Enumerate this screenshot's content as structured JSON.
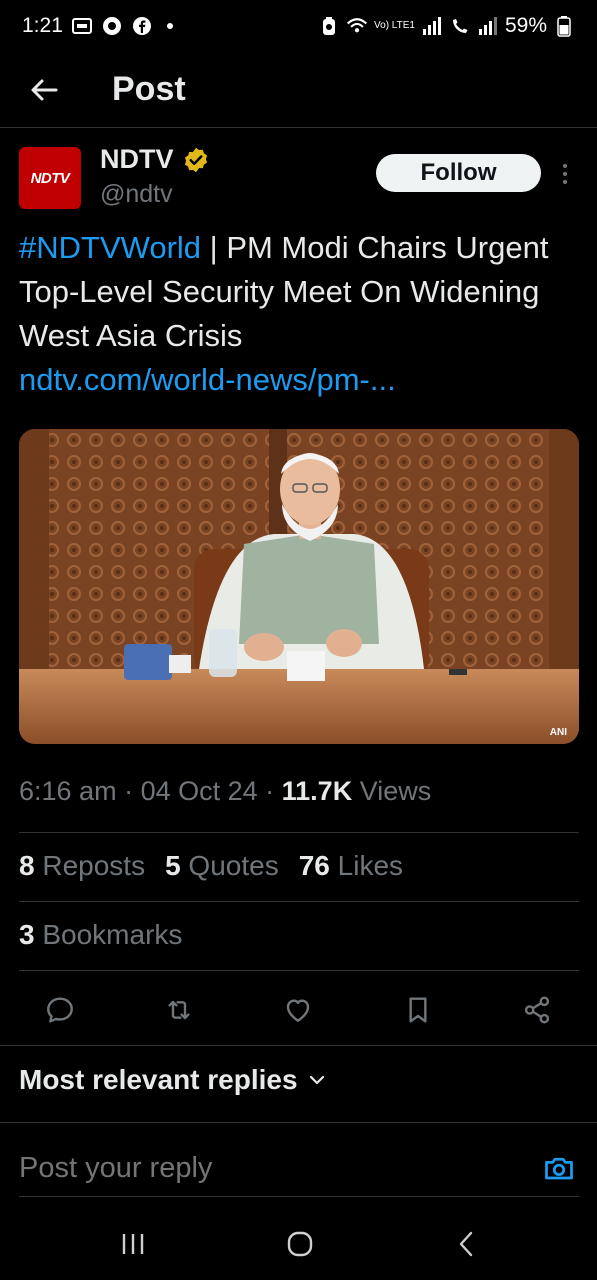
{
  "status_bar": {
    "time": "1:21",
    "signal_label": "Vo) LTE1",
    "battery": "59%"
  },
  "header": {
    "title": "Post"
  },
  "author": {
    "display_name": "NDTV",
    "handle": "@ndtv",
    "avatar_text": "NDTV",
    "verified_color": "#e2b719",
    "follow_label": "Follow"
  },
  "tweet": {
    "hashtag": "#NDTVWorld",
    "separator": " | ",
    "text": "PM Modi Chairs Urgent Top-Level Security Meet On Widening West Asia Crisis",
    "link": "ndtv.com/world-news/pm-...",
    "media_credit": "ANI"
  },
  "meta": {
    "time": "6:16 am",
    "dot1": " · ",
    "date": "04 Oct 24",
    "dot2": " · ",
    "views_count": "11.7K",
    "views_label": " Views"
  },
  "stats": {
    "reposts_count": "8",
    "reposts_label": " Reposts",
    "quotes_count": "5",
    "quotes_label": " Quotes",
    "likes_count": "76",
    "likes_label": " Likes",
    "bookmarks_count": "3",
    "bookmarks_label": " Bookmarks"
  },
  "replies": {
    "sort_label": "Most relevant replies",
    "placeholder": "Post your reply"
  },
  "colors": {
    "accent": "#1d9bf0",
    "background": "#000000",
    "muted": "#71767b",
    "avatar_red": "#c00000"
  }
}
